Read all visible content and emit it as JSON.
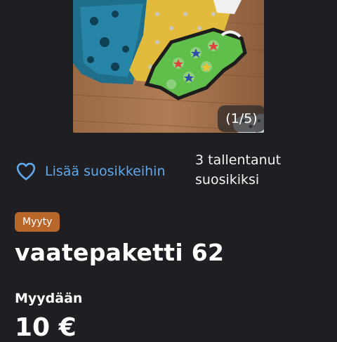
{
  "gallery": {
    "counter": "(1/5)"
  },
  "favorite": {
    "label": "Lisää suosikkeihin",
    "icon": "heart-outline-icon",
    "color": "#5fa8ea"
  },
  "saved_count": {
    "line1": "3 tallentanut",
    "line2": "suosikiksi"
  },
  "listing": {
    "status": "Myyty",
    "status_color": "#b9662b",
    "title": "vaatepaketti 62",
    "sale_type": "Myydään",
    "price": "10 €"
  },
  "colors": {
    "background": "#1f1e23",
    "text": "#ffffff"
  }
}
